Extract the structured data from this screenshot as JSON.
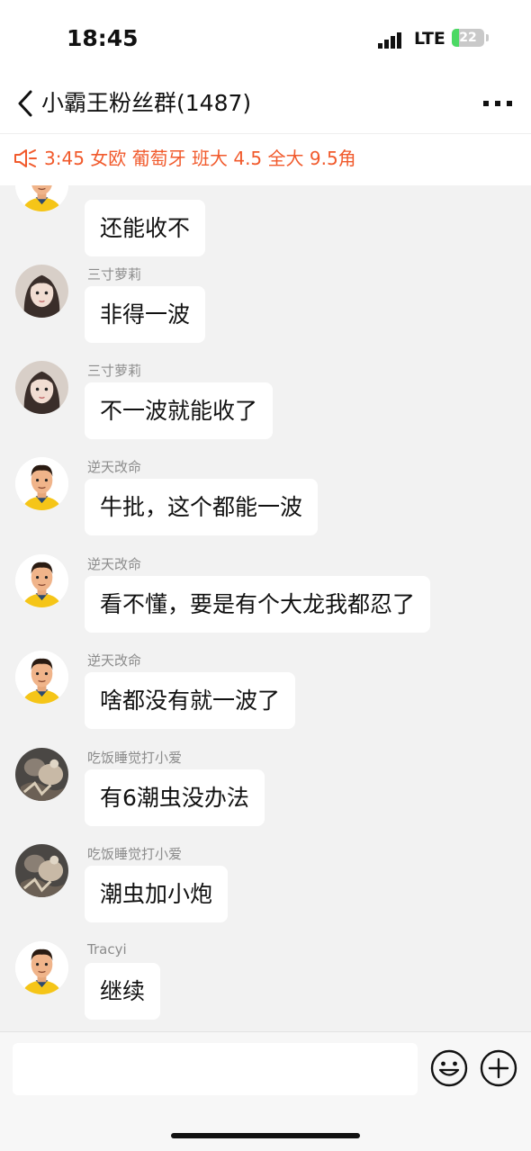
{
  "status_bar": {
    "time": "18:45",
    "carrier": "LTE",
    "battery": "22",
    "battery_level": 0.22
  },
  "header": {
    "title": "小霸王粉丝群(1487)",
    "back_icon": "chevron-left-icon",
    "more_icon": "more-icon"
  },
  "notice": {
    "text": "3:45 女欧 葡萄牙 班大 4.5 全大 9.5角",
    "icon": "speaker-icon",
    "color": "#f15a2c"
  },
  "messages": [
    {
      "sender": "",
      "text": "还能收不",
      "avatar": "avatar-cartoon"
    },
    {
      "sender": "三寸萝莉",
      "text": "非得一波",
      "avatar": "avatar-girl"
    },
    {
      "sender": "三寸萝莉",
      "text": "不一波就能收了",
      "avatar": "avatar-girl"
    },
    {
      "sender": "逆天改命",
      "text": "牛批，这个都能一波",
      "avatar": "avatar-cartoon"
    },
    {
      "sender": "逆天改命",
      "text": "看不懂，要是有个大龙我都忍了",
      "avatar": "avatar-cartoon"
    },
    {
      "sender": "逆天改命",
      "text": "啥都没有就一波了",
      "avatar": "avatar-cartoon"
    },
    {
      "sender": "吃饭睡觉打小爱",
      "text": "有6潮虫没办法",
      "avatar": "avatar-photo"
    },
    {
      "sender": "吃饭睡觉打小爱",
      "text": "潮虫加小炮",
      "avatar": "avatar-photo"
    },
    {
      "sender": "Tracyi",
      "text": "继续",
      "avatar": "avatar-cartoon"
    }
  ],
  "input_bar": {
    "placeholder": "",
    "emoji_icon": "emoji-icon",
    "plus_icon": "plus-icon"
  }
}
